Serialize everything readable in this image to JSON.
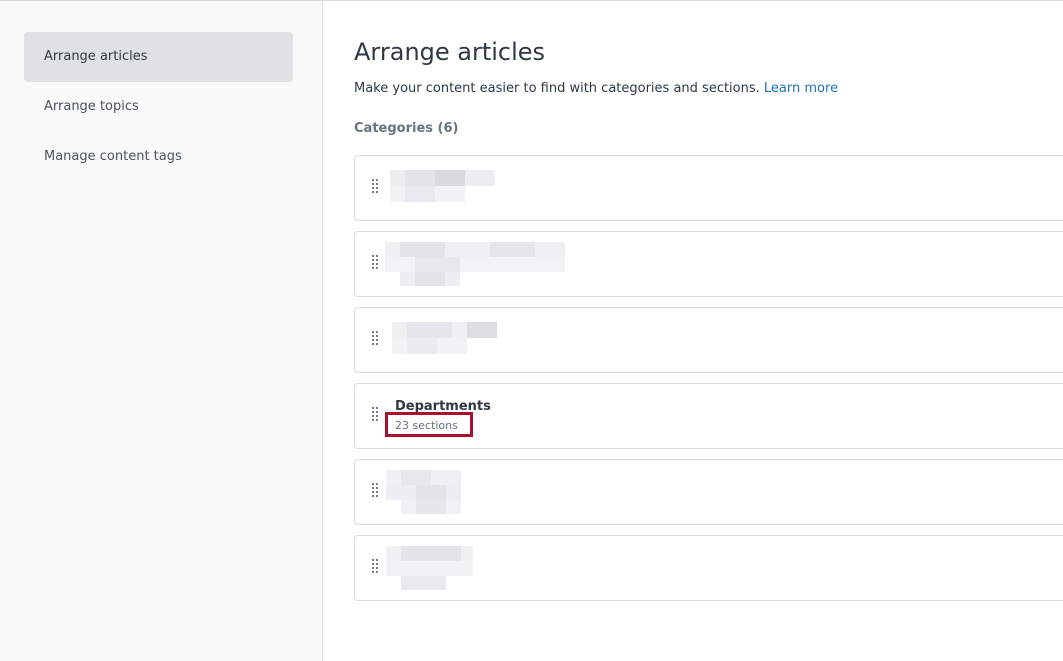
{
  "sidebar": {
    "items": [
      {
        "label": "Arrange articles",
        "active": true
      },
      {
        "label": "Arrange topics",
        "active": false
      },
      {
        "label": "Manage content tags",
        "active": false
      }
    ]
  },
  "main": {
    "title": "Arrange articles",
    "description": "Make your content easier to find with categories and sections.",
    "learn_more": "Learn more",
    "categories_heading": "Categories (6)",
    "categories": [
      {
        "name": "",
        "sections": "",
        "redacted": true
      },
      {
        "name": "",
        "sections": "",
        "redacted": true
      },
      {
        "name": "",
        "sections": "",
        "redacted": true
      },
      {
        "name": "Departments",
        "sections": "23 sections",
        "redacted": false,
        "highlighted": true
      },
      {
        "name": "",
        "sections": "",
        "redacted": true
      },
      {
        "name": "",
        "sections": "",
        "redacted": true
      }
    ]
  },
  "colors": {
    "link": "#1f73b7",
    "highlight_border": "#a8102e",
    "sidebar_active_bg": "#dfe2e4"
  },
  "icons": {
    "drag_handle": "grip-vertical-icon"
  }
}
